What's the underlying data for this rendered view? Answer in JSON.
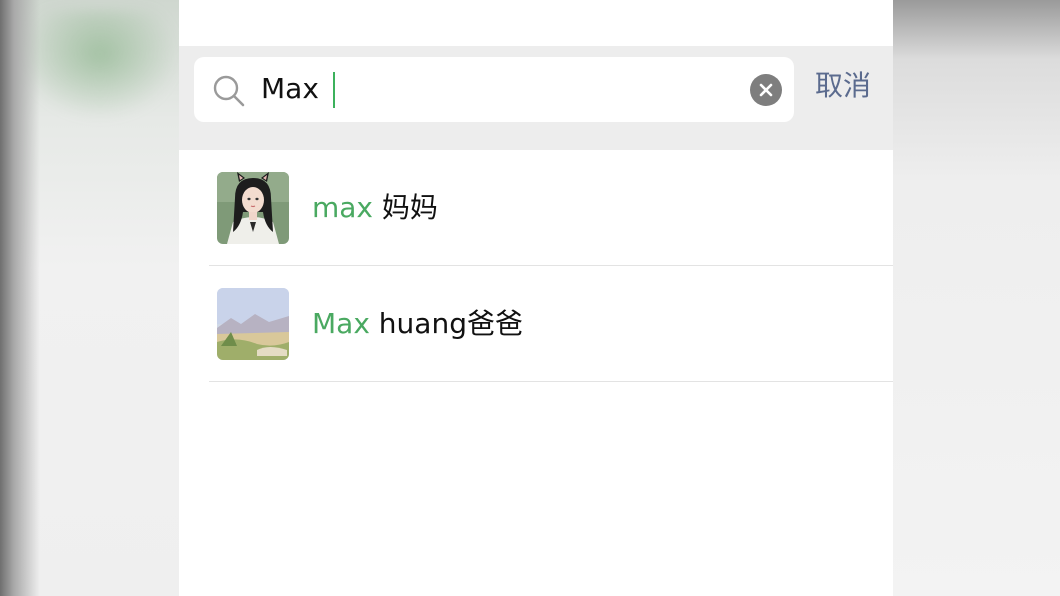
{
  "search": {
    "value": "Max",
    "placeholder": "",
    "cancel_label": "取消"
  },
  "results": [
    {
      "highlight": "max",
      "rest": " 妈妈",
      "avatar": "avatar-girl-cat-ears"
    },
    {
      "highlight": "Max",
      "rest": " huang爸爸",
      "avatar": "avatar-landscape-painting"
    }
  ],
  "colors": {
    "highlight": "#4aa961",
    "cancel": "#5b6b8e",
    "search_bg": "#ededed"
  },
  "icons": [
    "search-icon",
    "clear-icon"
  ]
}
